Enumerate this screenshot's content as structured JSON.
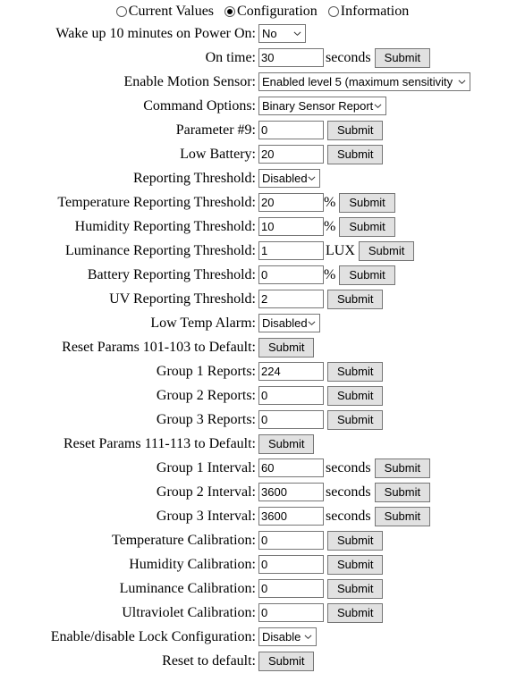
{
  "modes": [
    {
      "label": "Current Values",
      "selected": false,
      "name": "current-values"
    },
    {
      "label": "Configuration",
      "selected": true,
      "name": "configuration"
    },
    {
      "label": "Information",
      "selected": false,
      "name": "information"
    }
  ],
  "submit_label": "Submit",
  "units": {
    "seconds": "seconds",
    "percent": "%",
    "lux": "LUX"
  },
  "rows": [
    {
      "label": "Wake up 10 minutes on Power On:",
      "type": "select",
      "value": "No"
    },
    {
      "label": "On time:",
      "type": "text",
      "value": "30",
      "unit": "seconds"
    },
    {
      "label": "Enable Motion Sensor:",
      "type": "select",
      "value": "Enabled level 5 (maximum sensitivity"
    },
    {
      "label": "Command Options:",
      "type": "select",
      "value": "Binary Sensor Report"
    },
    {
      "label": "Parameter #9:",
      "type": "text",
      "value": "0"
    },
    {
      "label": "Low Battery:",
      "type": "text",
      "value": "20"
    },
    {
      "label": "Reporting Threshold:",
      "type": "select",
      "value": "Disabled"
    },
    {
      "label": "Temperature Reporting Threshold:",
      "type": "text",
      "value": "20",
      "unit": "%"
    },
    {
      "label": "Humidity Reporting Threshold:",
      "type": "text",
      "value": "10",
      "unit": "%"
    },
    {
      "label": "Luminance Reporting Threshold:",
      "type": "text",
      "value": "1",
      "unit": "LUX"
    },
    {
      "label": "Battery Reporting Threshold:",
      "type": "text",
      "value": "0",
      "unit": "%"
    },
    {
      "label": "UV Reporting Threshold:",
      "type": "text",
      "value": "2"
    },
    {
      "label": "Low Temp Alarm:",
      "type": "select",
      "value": "Disabled"
    },
    {
      "label": "Reset Params 101-103 to Default:",
      "type": "button"
    },
    {
      "label": "Group 1 Reports:",
      "type": "text",
      "value": "224"
    },
    {
      "label": "Group 2 Reports:",
      "type": "text",
      "value": "0"
    },
    {
      "label": "Group 3 Reports:",
      "type": "text",
      "value": "0"
    },
    {
      "label": "Reset Params 111-113 to Default:",
      "type": "button"
    },
    {
      "label": "Group 1 Interval:",
      "type": "text",
      "value": "60",
      "unit": "seconds"
    },
    {
      "label": "Group 2 Interval:",
      "type": "text",
      "value": "3600",
      "unit": "seconds"
    },
    {
      "label": "Group 3 Interval:",
      "type": "text",
      "value": "3600",
      "unit": "seconds"
    },
    {
      "label": "Temperature Calibration:",
      "type": "text",
      "value": "0"
    },
    {
      "label": "Humidity Calibration:",
      "type": "text",
      "value": "0"
    },
    {
      "label": "Luminance Calibration:",
      "type": "text",
      "value": "0"
    },
    {
      "label": "Ultraviolet Calibration:",
      "type": "text",
      "value": "0"
    },
    {
      "label": "Enable/disable Lock Configuration:",
      "type": "select",
      "value": "Disable"
    },
    {
      "label": "Reset to default:",
      "type": "button"
    }
  ]
}
